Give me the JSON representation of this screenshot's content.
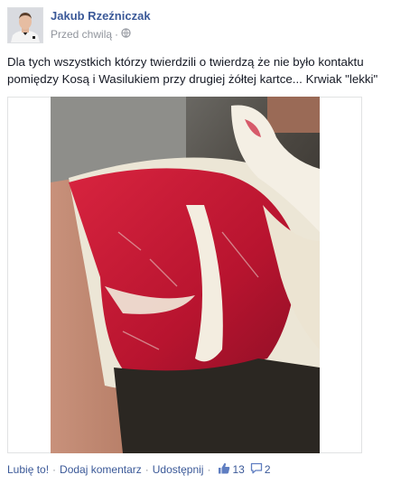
{
  "post": {
    "author": "Jakub Rzeźniczak",
    "timestamp": "Przed chwilą",
    "meta_separator": "·",
    "privacy_icon": "globe-icon",
    "text": "Dla tych wszystkich którzy twierdzili o twierdzą że nie było kontaktu pomiędzy Kosą i Wasilukiem przy drugiej żółtej kartce... Krwiak \"lekki\""
  },
  "actions": {
    "like_label": "Lubię to!",
    "comment_label": "Dodaj komentarz",
    "share_label": "Udostępnij",
    "separator": "·",
    "like_count": "13",
    "comment_count": "2",
    "like_icon": "thumbs-up-icon",
    "comment_icon": "speech-bubble-icon"
  },
  "colors": {
    "link": "#3b5998",
    "muted": "#90949c",
    "text": "#141823"
  }
}
